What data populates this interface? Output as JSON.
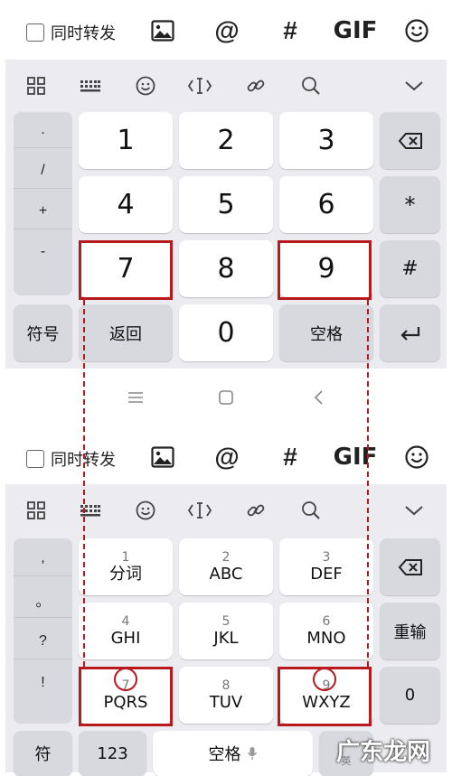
{
  "top": {
    "checkbox_label": "同时转发",
    "gif_label": "GIF",
    "suggestion_icons": [
      "grid-icon",
      "keyboard-icon",
      "emoji-icon",
      "cursor-icon",
      "link-icon",
      "search-icon",
      "chevron-down-icon"
    ],
    "side_symbols": [
      ".",
      "/",
      "+",
      "-"
    ],
    "keys": [
      "1",
      "2",
      "3",
      "4",
      "5",
      "6",
      "7",
      "8",
      "9",
      "0"
    ],
    "symbol_key": "符号",
    "back_key": "返回",
    "space_key": "空格",
    "star_key": "*",
    "hash_key": "#"
  },
  "bottom": {
    "checkbox_label": "同时转发",
    "gif_label": "GIF",
    "side_symbols": [
      ",",
      "。",
      "?",
      "!"
    ],
    "keys": [
      {
        "num": "1",
        "letters": "分词"
      },
      {
        "num": "2",
        "letters": "ABC"
      },
      {
        "num": "3",
        "letters": "DEF"
      },
      {
        "num": "4",
        "letters": "GHI"
      },
      {
        "num": "5",
        "letters": "JKL"
      },
      {
        "num": "6",
        "letters": "MNO"
      },
      {
        "num": "7",
        "letters": "PQRS"
      },
      {
        "num": "8",
        "letters": "TUV"
      },
      {
        "num": "9",
        "letters": "WXYZ"
      }
    ],
    "reenter_key": "重输",
    "zero_key": "0",
    "fu_key": "符",
    "num_key": "123",
    "space_key": "空格",
    "en_key": "英"
  },
  "watermark": "广东龙网",
  "colors": {
    "highlight": "#b8191f",
    "keyboard_bg": "#ececf0",
    "dark_key": "#d8d9de"
  }
}
